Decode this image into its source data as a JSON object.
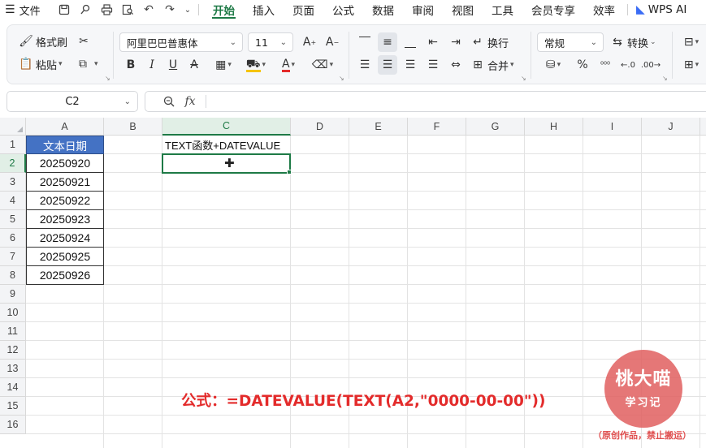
{
  "menubar": {
    "file_label": "文件",
    "tabs": [
      "开始",
      "插入",
      "页面",
      "公式",
      "数据",
      "审阅",
      "视图",
      "工具",
      "会员专享",
      "效率",
      "WPS AI"
    ],
    "active_tab": "开始"
  },
  "ribbon": {
    "format_painter": "格式刷",
    "paste": "粘贴",
    "font_name": "阿里巴巴普惠体",
    "font_size": "11",
    "wrap": "换行",
    "merge": "合并",
    "number_format": "常规",
    "convert": "转换",
    "percent": "%"
  },
  "formula_bar": {
    "cell_ref": "C2",
    "fx": "fx",
    "value": ""
  },
  "sheet": {
    "columns": [
      "A",
      "B",
      "C",
      "D",
      "E",
      "F",
      "G",
      "H",
      "I",
      "J"
    ],
    "rows": [
      "1",
      "2",
      "3",
      "4",
      "5",
      "6",
      "7",
      "8",
      "9",
      "10",
      "11",
      "12",
      "13",
      "14",
      "15",
      "16"
    ],
    "selected_column": "C",
    "selected_row": "2",
    "A1": "文本日期",
    "C1": "TEXT函数+DATEVALUE",
    "A_values": [
      "20250920",
      "20250921",
      "20250922",
      "20250923",
      "20250924",
      "20250925",
      "20250926"
    ]
  },
  "caption": "公式：=DATEVALUE(TEXT(A2,\"0000-00-00\"))",
  "watermark": {
    "top": "桃大喵",
    "bottom": "学习记",
    "note": "（原创作品，禁止搬运）"
  },
  "colors": {
    "accent": "#1e7a46",
    "header_fill": "#4472c4",
    "caption": "#e32b2b"
  }
}
